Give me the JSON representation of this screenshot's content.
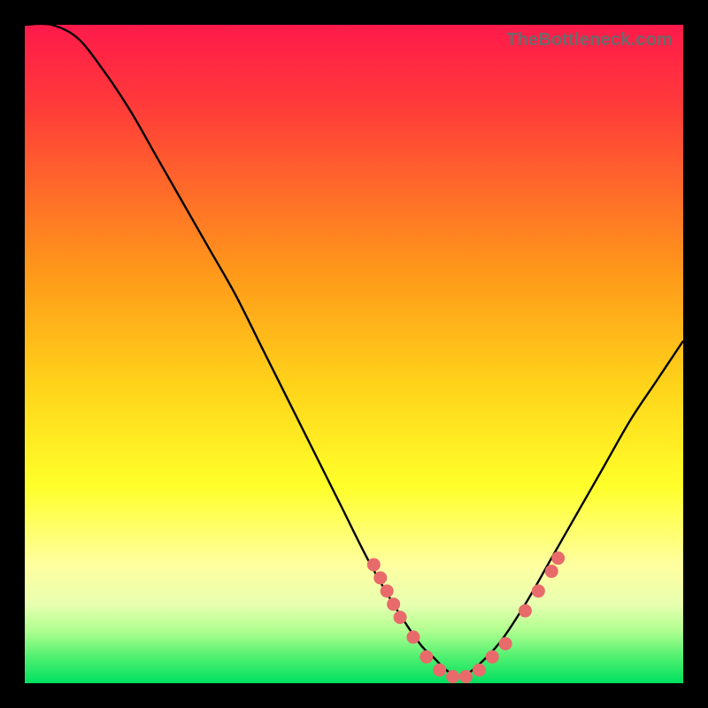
{
  "watermark": "TheBottleneck.com",
  "colors": {
    "background": "#000000",
    "gradient_top": "#ff1a4b",
    "gradient_bottom": "#00e060",
    "curve": "#000000",
    "marker": "#e86a6a"
  },
  "chart_data": {
    "type": "line",
    "title": "",
    "xlabel": "",
    "ylabel": "",
    "xlim": [
      0,
      100
    ],
    "ylim": [
      0,
      100
    ],
    "x": [
      0,
      4,
      8,
      12,
      16,
      20,
      24,
      28,
      32,
      36,
      40,
      44,
      48,
      52,
      56,
      60,
      62,
      64,
      66,
      68,
      72,
      76,
      80,
      84,
      88,
      92,
      96,
      100
    ],
    "values": [
      100,
      100,
      98,
      93,
      87,
      80,
      73,
      66,
      59,
      51,
      43,
      35,
      27,
      19,
      12,
      6,
      4,
      2,
      1,
      2,
      6,
      12,
      19,
      26,
      33,
      40,
      46,
      52
    ],
    "markers": [
      {
        "x": 53,
        "y": 18
      },
      {
        "x": 54,
        "y": 16
      },
      {
        "x": 55,
        "y": 14
      },
      {
        "x": 56,
        "y": 12
      },
      {
        "x": 57,
        "y": 10
      },
      {
        "x": 59,
        "y": 7
      },
      {
        "x": 61,
        "y": 4
      },
      {
        "x": 63,
        "y": 2
      },
      {
        "x": 65,
        "y": 1
      },
      {
        "x": 67,
        "y": 1
      },
      {
        "x": 69,
        "y": 2
      },
      {
        "x": 71,
        "y": 4
      },
      {
        "x": 73,
        "y": 6
      },
      {
        "x": 76,
        "y": 11
      },
      {
        "x": 78,
        "y": 14
      },
      {
        "x": 80,
        "y": 17
      },
      {
        "x": 81,
        "y": 19
      }
    ]
  }
}
